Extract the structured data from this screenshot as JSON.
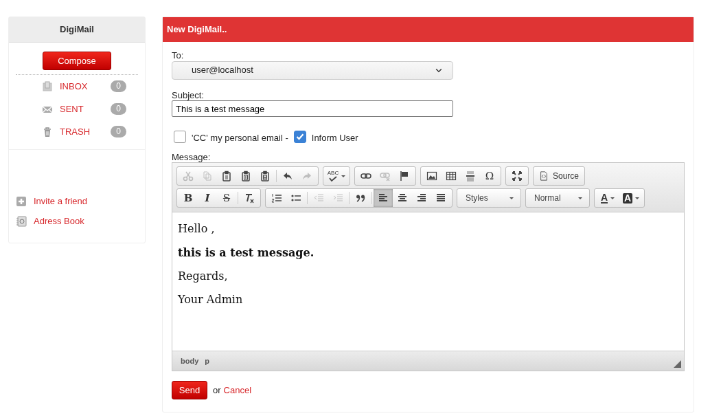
{
  "sidebar": {
    "title": "DigiMail",
    "compose": "Compose",
    "folders": [
      {
        "label": "INBOX",
        "count": "0"
      },
      {
        "label": "SENT",
        "count": "0"
      },
      {
        "label": "TRASH",
        "count": "0"
      }
    ],
    "links": [
      {
        "label": "Invite a friend"
      },
      {
        "label": "Adress Book"
      }
    ]
  },
  "compose": {
    "title": "New DigiMail..",
    "to_label": "To:",
    "to_value": "user@localhost",
    "subject_label": "Subject:",
    "subject_value": "This is a test message",
    "options": [
      {
        "label": "'CC' my personal email -",
        "checked": false
      },
      {
        "label": "Inform User",
        "checked": true
      }
    ],
    "message_label": "Message:",
    "toolbar": [
      [
        [
          {
            "kind": "icon",
            "disabled": true
          },
          {
            "kind": "icon",
            "disabled": true
          },
          {
            "kind": "icon",
            "disabled": false
          },
          {
            "kind": "icon",
            "disabled": false
          },
          {
            "kind": "icon",
            "disabled": false
          },
          {
            "kind": "sep"
          },
          {
            "kind": "icon",
            "disabled": false
          },
          {
            "kind": "icon",
            "disabled": true
          }
        ],
        [
          {
            "kind": "spell",
            "label": "ABC"
          }
        ],
        [
          {
            "kind": "icon",
            "disabled": false
          },
          {
            "kind": "icon",
            "disabled": true
          },
          {
            "kind": "icon",
            "disabled": false
          }
        ],
        [
          {
            "kind": "icon",
            "disabled": false
          },
          {
            "kind": "icon",
            "disabled": false
          },
          {
            "kind": "icon",
            "disabled": false
          },
          {
            "kind": "glyph",
            "label": "Ω"
          }
        ],
        [
          {
            "kind": "icon",
            "disabled": false
          }
        ],
        [
          {
            "kind": "text",
            "label": "Source"
          }
        ]
      ],
      [
        [
          {
            "kind": "glyph",
            "label": "B"
          },
          {
            "kind": "glyph",
            "label": "I"
          },
          {
            "kind": "glyph",
            "label": "S"
          },
          {
            "kind": "sep"
          },
          {
            "kind": "icon",
            "disabled": false
          }
        ],
        [
          {
            "kind": "icon",
            "disabled": false
          },
          {
            "kind": "icon",
            "disabled": false
          },
          {
            "kind": "sep"
          },
          {
            "kind": "icon",
            "disabled": true
          },
          {
            "kind": "icon",
            "disabled": true
          },
          {
            "kind": "sep"
          },
          {
            "kind": "icon",
            "disabled": false
          },
          {
            "kind": "sep"
          },
          {
            "kind": "icon",
            "disabled": false,
            "selected": true
          },
          {
            "kind": "icon",
            "disabled": false,
            "selected": false
          },
          {
            "kind": "icon",
            "disabled": false,
            "selected": false
          },
          {
            "kind": "icon",
            "disabled": false,
            "selected": false
          }
        ],
        [
          {
            "kind": "combo",
            "label": "Styles"
          }
        ],
        [
          {
            "kind": "combo",
            "label": "Normal"
          }
        ],
        [
          {
            "kind": "fgcolor",
            "label": "A"
          },
          {
            "kind": "bgcolor",
            "label": "A"
          }
        ]
      ]
    ],
    "body": [
      {
        "text": "Hello ,",
        "bold": false
      },
      {
        "text": "this is a test message.",
        "bold": true
      },
      {
        "text": "Regards,",
        "bold": false
      },
      {
        "text": "Your Admin",
        "bold": false
      }
    ],
    "path": [
      "body",
      "p"
    ],
    "send": "Send",
    "or": "or",
    "cancel": "Cancel"
  }
}
